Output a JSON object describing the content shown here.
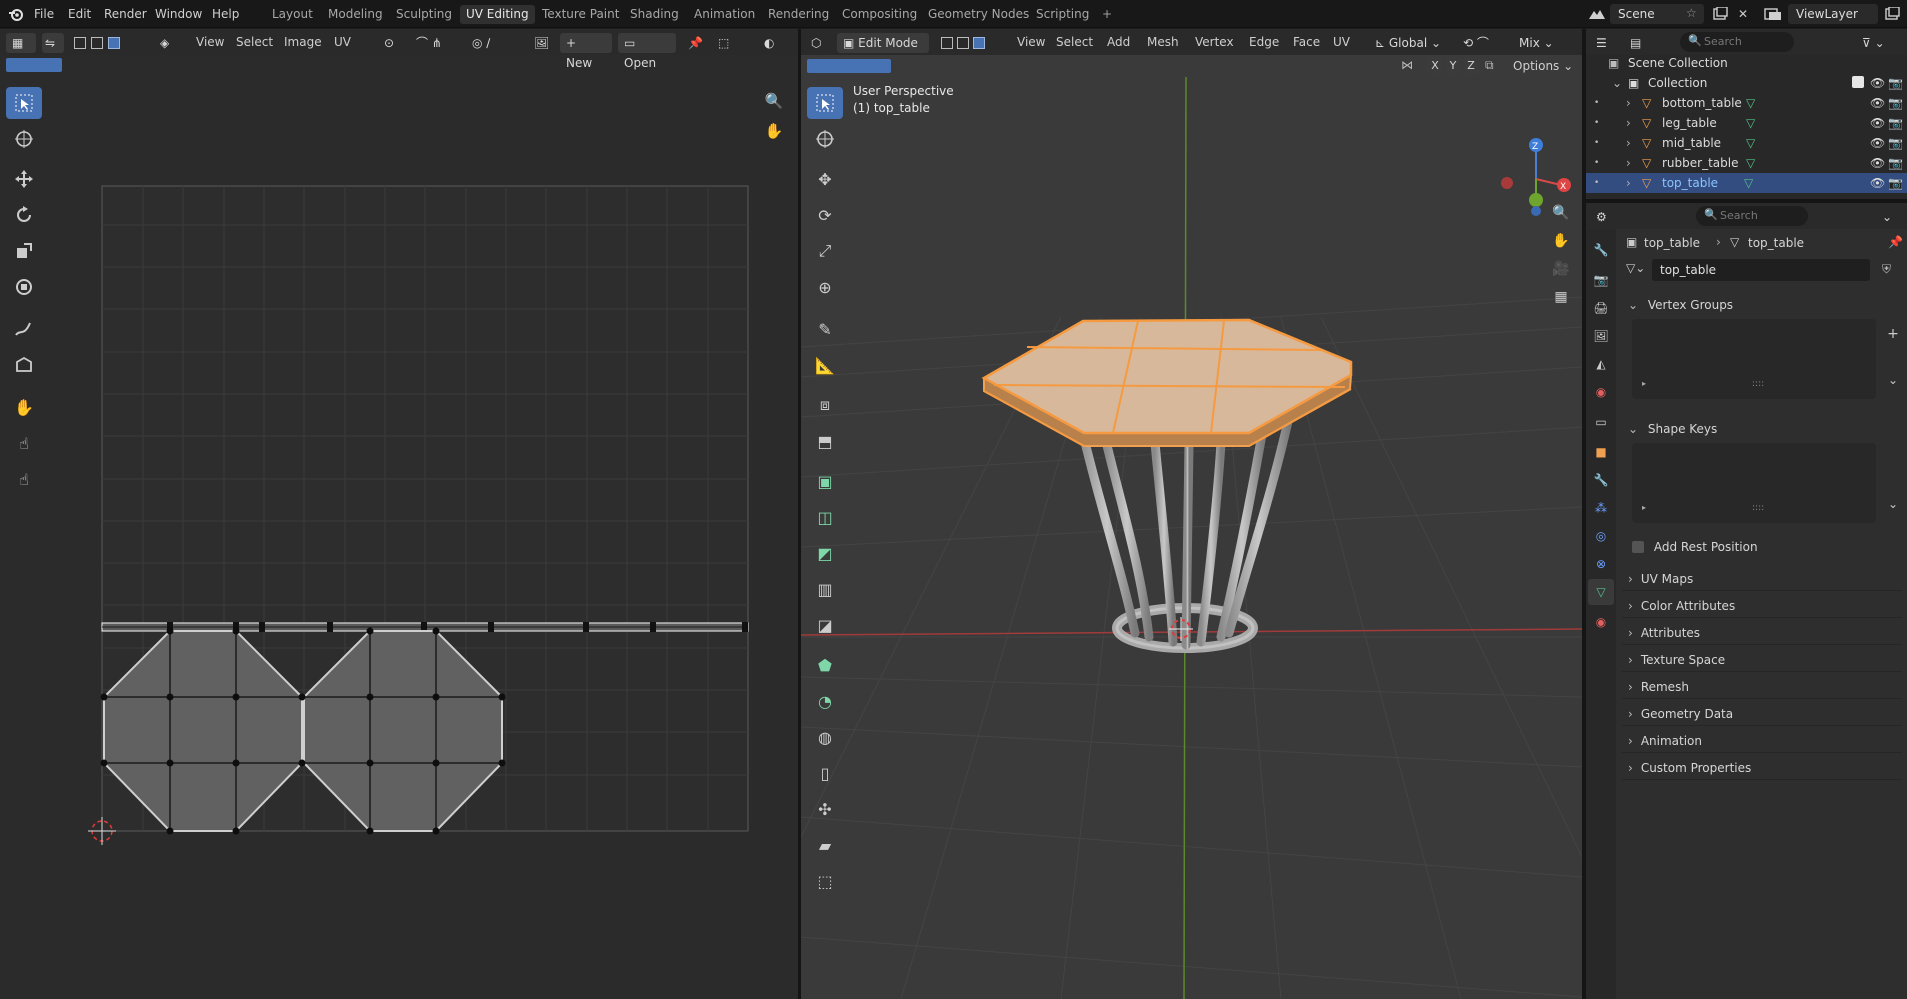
{
  "topbar": {
    "menus": [
      "File",
      "Edit",
      "Render",
      "Window",
      "Help"
    ],
    "workspaces": [
      "Layout",
      "Modeling",
      "Sculpting",
      "UV Editing",
      "Texture Paint",
      "Shading",
      "Animation",
      "Rendering",
      "Compositing",
      "Geometry Nodes",
      "Scripting"
    ],
    "active_workspace": "UV Editing",
    "scene_label": "Scene",
    "viewlayer_label": "ViewLayer"
  },
  "uv_editor": {
    "menus": [
      "View",
      "Select",
      "Image",
      "UV"
    ],
    "new_label": "New",
    "open_label": "Open"
  },
  "viewport": {
    "mode": "Edit Mode",
    "menus": [
      "View",
      "Select",
      "Add",
      "Mesh",
      "Vertex",
      "Edge",
      "Face",
      "UV"
    ],
    "orientation": "Global",
    "shading": "Mix",
    "axis_x": "X",
    "axis_y": "Y",
    "axis_z": "Z",
    "options_label": "Options",
    "view_name": "User Perspective",
    "object_label": "(1) top_table"
  },
  "outliner": {
    "search_placeholder": "Search",
    "scene_collection": "Scene Collection",
    "collection": "Collection",
    "items": [
      {
        "name": "bottom_table"
      },
      {
        "name": "leg_table"
      },
      {
        "name": "mid_table"
      },
      {
        "name": "rubber_table"
      },
      {
        "name": "top_table"
      }
    ],
    "selected": "top_table"
  },
  "properties": {
    "search_placeholder": "Search",
    "breadcrumb_object": "top_table",
    "breadcrumb_mesh": "top_table",
    "mesh_name": "top_table",
    "vertex_groups": "Vertex Groups",
    "shape_keys": "Shape Keys",
    "add_rest_position": "Add Rest Position",
    "sections": [
      "UV Maps",
      "Color Attributes",
      "Attributes",
      "Texture Space",
      "Remesh",
      "Geometry Data",
      "Animation",
      "Custom Properties"
    ]
  },
  "colors": {
    "accent": "#4772b3",
    "selection_orange": "#f0a050",
    "mesh_icon_green": "#52c38a"
  }
}
